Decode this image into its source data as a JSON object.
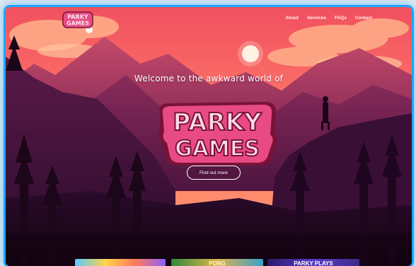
{
  "nav": {
    "logo_text": "PARKY GAMES",
    "links": [
      "About",
      "Services",
      "FAQs",
      "Contact"
    ]
  },
  "hero": {
    "tagline": "Welcome to the awkward world of",
    "logo_line1": "PARKY",
    "logo_line2": "GAMES",
    "cta_label": "Find out more"
  },
  "thumbnails": {
    "items": [
      {
        "label": ""
      },
      {
        "label": "PONG"
      },
      {
        "label": "PARKY PLAYS"
      }
    ]
  },
  "colors": {
    "sky_top": "#f25b6a",
    "sky_mid": "#ff8c68",
    "mountain_dark": "#2a0b2b",
    "accent_pink": "#e84b83",
    "frame_glow": "#1aa6ff"
  }
}
